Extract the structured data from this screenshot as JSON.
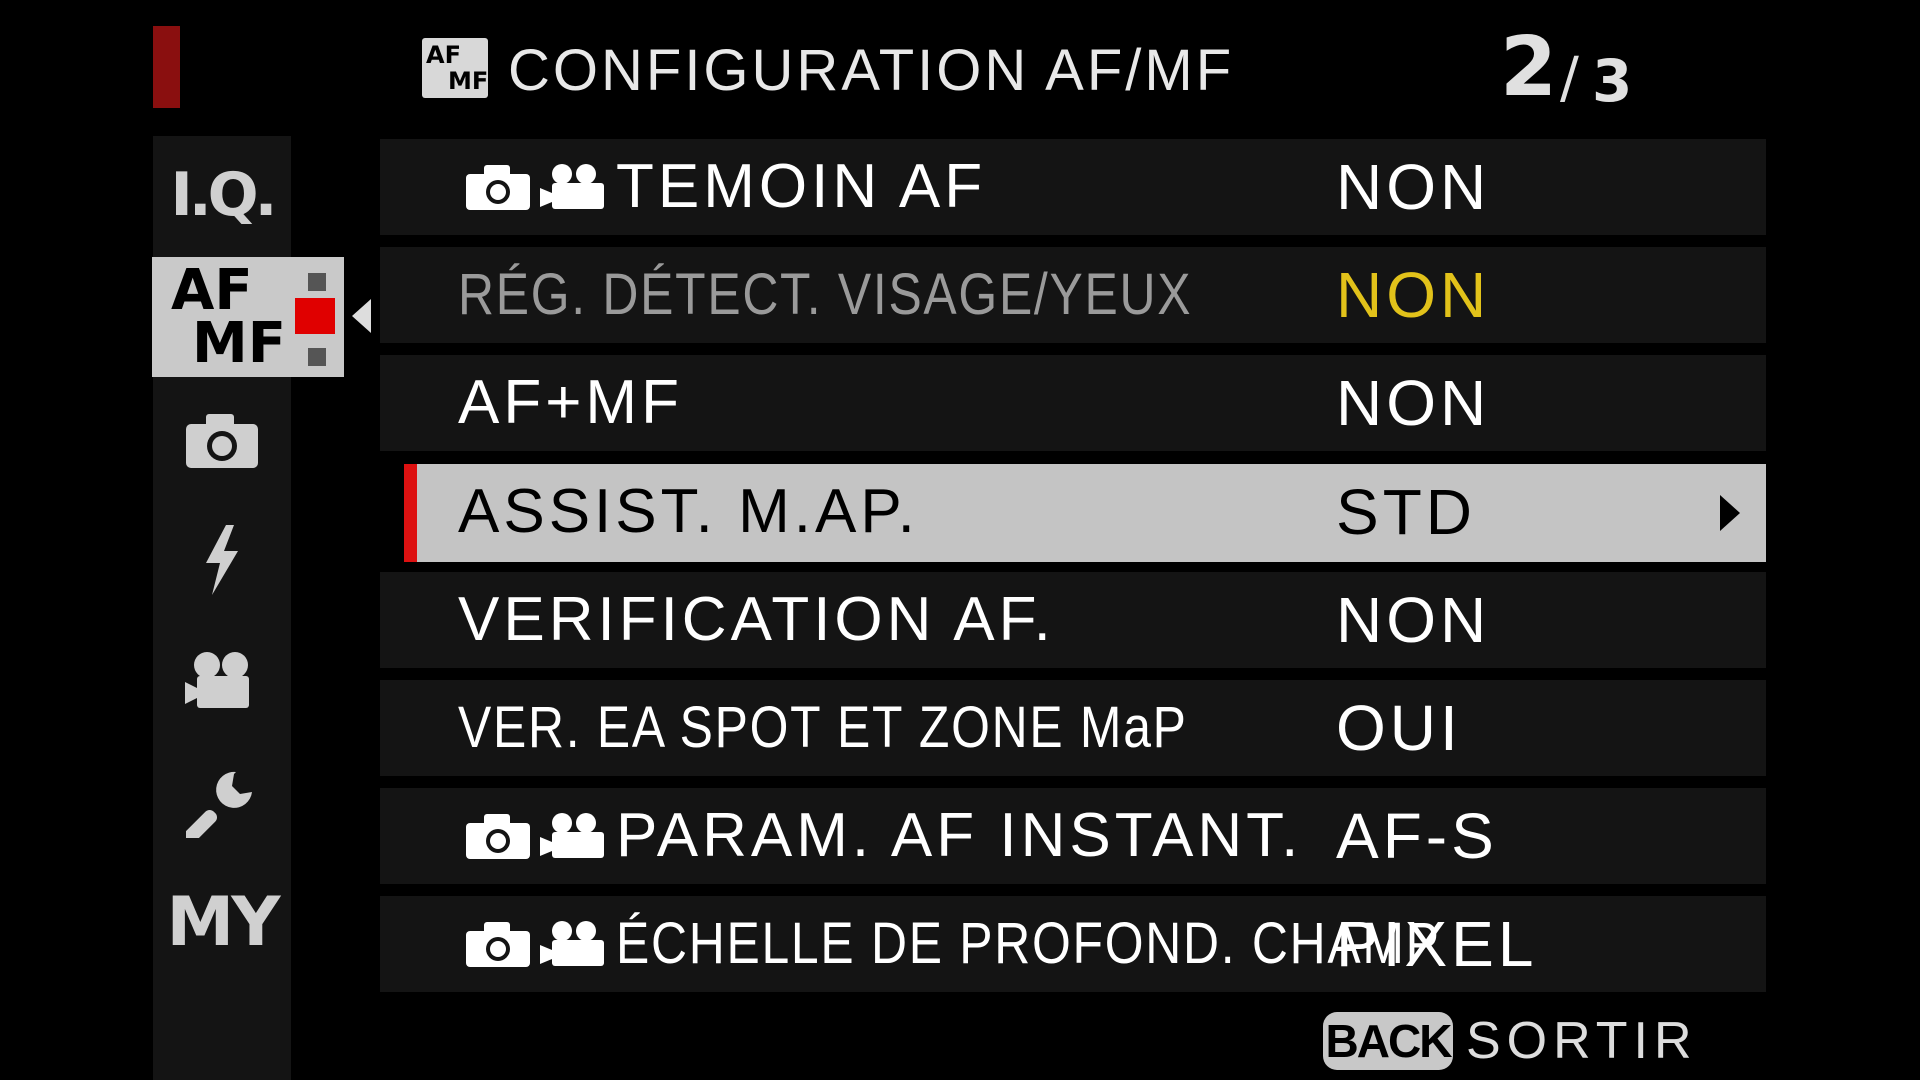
{
  "header": {
    "icon_top": "AF",
    "icon_bottom": "MF",
    "title": "CONFIGURATION AF/MF",
    "page_current": "2",
    "page_separator": "/",
    "page_total": "3"
  },
  "sidebar": {
    "items": [
      {
        "label": "I.Q.",
        "icon": "image-quality-icon"
      },
      {
        "label_top": "AF",
        "label_bottom": "MF",
        "icon": "af-mf-icon",
        "selected": true
      },
      {
        "icon": "camera-icon"
      },
      {
        "icon": "flash-icon"
      },
      {
        "icon": "movie-icon"
      },
      {
        "icon": "wrench-icon"
      },
      {
        "label": "MY",
        "icon": "my-menu-icon"
      }
    ]
  },
  "menu": {
    "rows": [
      {
        "label": "TEMOIN AF",
        "value": "NON",
        "icons": [
          "camera-icon",
          "movie-icon"
        ]
      },
      {
        "label": "RÉG. DÉTECT. VISAGE/YEUX",
        "value": "NON",
        "disabled": true
      },
      {
        "label": "AF+MF",
        "value": "NON"
      },
      {
        "label": "ASSIST. M.AP.",
        "value": "STD",
        "selected": true
      },
      {
        "label": "VERIFICATION AF.",
        "value": "NON"
      },
      {
        "label": "VER. EA SPOT ET ZONE MaP",
        "value": "OUI"
      },
      {
        "label": "PARAM. AF INSTANT.",
        "value": "AF-S",
        "icons": [
          "camera-icon",
          "movie-icon"
        ]
      },
      {
        "label": "ÉCHELLE DE PROFOND. CHAMP",
        "value": "PIXEL",
        "icons": [
          "camera-icon",
          "movie-icon"
        ]
      }
    ]
  },
  "footer": {
    "back_label": "BACK",
    "exit_label": "SORTIR"
  },
  "colors": {
    "accent_red": "#d11111",
    "disabled_value": "#e2c21a",
    "selection_bg": "#c4c4c4"
  }
}
